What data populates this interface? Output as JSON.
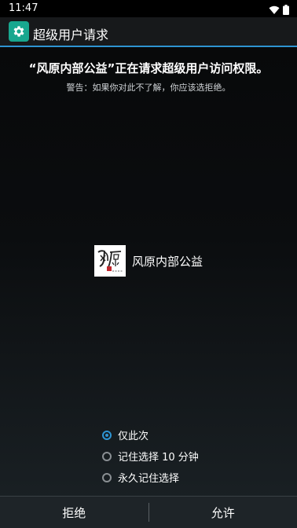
{
  "status_bar": {
    "time": "11:47",
    "icons": [
      "wifi-icon",
      "battery-icon"
    ]
  },
  "action_bar": {
    "icon": "gear-icon",
    "title": "超级用户请求"
  },
  "request": {
    "title": "“风原内部公益”正在请求超级用户访问权限。",
    "warning": "警告：如果你对此不了解，你应该选拒绝。"
  },
  "app": {
    "name": "风原内部公益",
    "logo_text": "风原"
  },
  "options": [
    {
      "label": "仅此次",
      "checked": true
    },
    {
      "label": "记住选择 10 分钟",
      "checked": false
    },
    {
      "label": "永久记住选择",
      "checked": false
    }
  ],
  "buttons": {
    "deny": "拒绝",
    "allow": "允许"
  },
  "colors": {
    "accent": "#2e94d2",
    "app_icon": "#18a78f",
    "logo_seal": "#c0272d"
  }
}
